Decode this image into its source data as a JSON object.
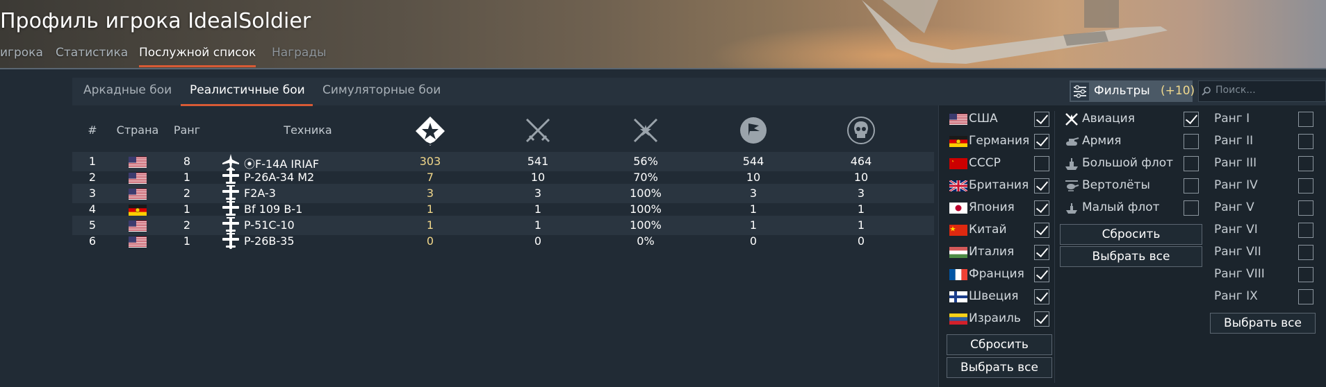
{
  "header": {
    "title": "Профиль игрока IdealSoldier",
    "tabs": [
      {
        "label": "игрока"
      },
      {
        "label": "Статистика"
      },
      {
        "label": "Послужной список"
      },
      {
        "label": "Награды"
      }
    ]
  },
  "subtabs": [
    {
      "label": "Аркадные бои"
    },
    {
      "label": "Реалистичные бои"
    },
    {
      "label": "Симуляторные бои"
    }
  ],
  "filter": {
    "label": "Фильтры",
    "count": "(+10)"
  },
  "search": {
    "placeholder": "Поиск..."
  },
  "table": {
    "headers": {
      "num": "#",
      "country": "Страна",
      "rank": "Ранг",
      "vehicle": "Техника"
    },
    "stat_icons": [
      "battles-icon",
      "kills-icon",
      "wins-percent-icon",
      "capture-icon",
      "deaths-skull-icon"
    ],
    "rows": [
      {
        "num": "1",
        "country": "usa",
        "rank": "8",
        "type": "jet",
        "name": "⦿F-14A IRIAF",
        "battles": "303",
        "kills": "541",
        "winrate": "56%",
        "capture": "544",
        "deaths": "464"
      },
      {
        "num": "2",
        "country": "usa",
        "rank": "1",
        "type": "prop",
        "name": "P-26A-34 M2",
        "battles": "7",
        "kills": "10",
        "winrate": "70%",
        "capture": "10",
        "deaths": "10"
      },
      {
        "num": "3",
        "country": "usa",
        "rank": "2",
        "type": "prop",
        "name": "F2A-3",
        "battles": "3",
        "kills": "3",
        "winrate": "100%",
        "capture": "3",
        "deaths": "3"
      },
      {
        "num": "4",
        "country": "germany",
        "rank": "1",
        "type": "prop",
        "name": "Bf 109 B-1",
        "battles": "1",
        "kills": "1",
        "winrate": "100%",
        "capture": "1",
        "deaths": "1"
      },
      {
        "num": "5",
        "country": "usa",
        "rank": "2",
        "type": "prop",
        "name": "P-51C-10",
        "battles": "1",
        "kills": "1",
        "winrate": "100%",
        "capture": "1",
        "deaths": "1"
      },
      {
        "num": "6",
        "country": "usa",
        "rank": "1",
        "type": "prop",
        "name": "P-26B-35",
        "battles": "0",
        "kills": "0",
        "winrate": "0%",
        "capture": "0",
        "deaths": "0"
      }
    ]
  },
  "countries": [
    {
      "label": "США",
      "flag": "usa",
      "checked": true
    },
    {
      "label": "Германия",
      "flag": "germany",
      "checked": true
    },
    {
      "label": "СССР",
      "flag": "ussr",
      "checked": false
    },
    {
      "label": "Британия",
      "flag": "britain",
      "checked": true
    },
    {
      "label": "Япония",
      "flag": "japan",
      "checked": true
    },
    {
      "label": "Китай",
      "flag": "china",
      "checked": true
    },
    {
      "label": "Италия",
      "flag": "italy",
      "checked": true
    },
    {
      "label": "Франция",
      "flag": "france",
      "checked": true
    },
    {
      "label": "Швеция",
      "flag": "sweden",
      "checked": true
    },
    {
      "label": "Израиль",
      "flag": "israel",
      "checked": true
    }
  ],
  "types": [
    {
      "label": "Авиация",
      "icon": "aviation-icon",
      "checked": true
    },
    {
      "label": "Армия",
      "icon": "tank-icon",
      "checked": false
    },
    {
      "label": "Большой флот",
      "icon": "big-fleet-icon",
      "checked": false
    },
    {
      "label": "Вертолёты",
      "icon": "helicopter-icon",
      "checked": false
    },
    {
      "label": "Малый флот",
      "icon": "small-fleet-icon",
      "checked": false
    }
  ],
  "ranks": [
    {
      "label": "Ранг I",
      "checked": false
    },
    {
      "label": "Ранг II",
      "checked": false
    },
    {
      "label": "Ранг III",
      "checked": false
    },
    {
      "label": "Ранг IV",
      "checked": false
    },
    {
      "label": "Ранг V",
      "checked": false
    },
    {
      "label": "Ранг VI",
      "checked": false
    },
    {
      "label": "Ранг VII",
      "checked": false
    },
    {
      "label": "Ранг VIII",
      "checked": false
    },
    {
      "label": "Ранг IX",
      "checked": false
    }
  ],
  "buttons": {
    "reset": "Сбросить",
    "select_all": "Выбрать все"
  },
  "colors": {
    "accent": "#d85a35",
    "highlight_yellow": "#f1d78a",
    "panel": "#1b242c",
    "background": "#212b35"
  }
}
